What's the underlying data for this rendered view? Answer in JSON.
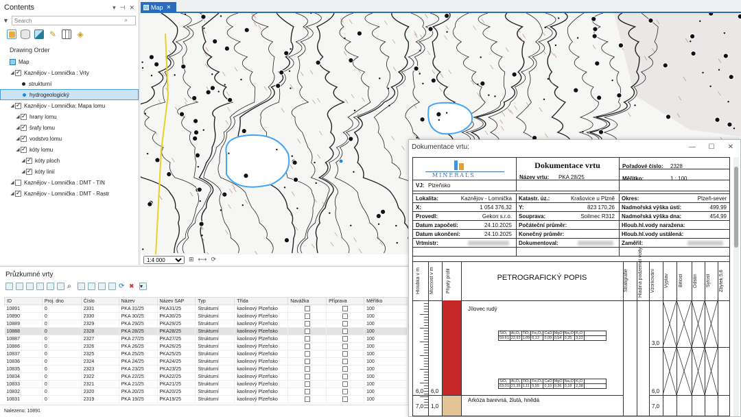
{
  "contents": {
    "title": "Contents",
    "search_placeholder": "Search",
    "section": "Drawing Order",
    "tree": [
      {
        "label": "Map",
        "level": 0,
        "checkbox": false,
        "caret": false
      },
      {
        "label": "Kaznějov - Lomnička : Vrty",
        "level": 1,
        "checkbox": true,
        "checked": true,
        "caret": true
      },
      {
        "label": "strukturní",
        "level": 2,
        "symbol": "#222222"
      },
      {
        "label": "hydrogeologický",
        "level": 2,
        "symbol": "#1e88e5",
        "selected": true
      },
      {
        "label": "Kaznějov - Lomnička: Mapa lomu",
        "level": 1,
        "checkbox": true,
        "checked": true,
        "caret": true
      },
      {
        "label": "hrany lomu",
        "level": 2,
        "checkbox": true,
        "checked": true,
        "caret": true
      },
      {
        "label": "šrafy lomu",
        "level": 2,
        "checkbox": true,
        "checked": true,
        "caret": true
      },
      {
        "label": "vodstvo lomu",
        "level": 2,
        "checkbox": true,
        "checked": true,
        "caret": true
      },
      {
        "label": "kóty lomu",
        "level": 2,
        "checkbox": true,
        "checked": true,
        "caret": true
      },
      {
        "label": "kóty ploch",
        "level": 3,
        "checkbox": true,
        "checked": true,
        "caret": true
      },
      {
        "label": "kóty linií",
        "level": 3,
        "checkbox": true,
        "checked": true,
        "caret": true
      },
      {
        "label": "Kaznějov - Lomnička : DMT - TIN",
        "level": 1,
        "checkbox": true,
        "checked": false,
        "caret": true
      },
      {
        "label": "Kaznějov - Lomnička : DMT - Rastr",
        "level": 1,
        "checkbox": true,
        "checked": true,
        "caret": true
      }
    ]
  },
  "map": {
    "tab_label": "Map",
    "scale": "1:4 000"
  },
  "table": {
    "title": "Průzkumné vrty",
    "columns": [
      "ID",
      "Proj. dno",
      "Číslo",
      "Název",
      "Název SAP",
      "Typ",
      "Třída",
      "Navážka",
      "Příprava",
      "Měřítko"
    ],
    "rows": [
      [
        "10891",
        "0",
        "2331",
        "PKA 31/25",
        "PKA31/25",
        "Strukturní",
        "kaolinový Plzeňsko",
        "",
        "",
        "100"
      ],
      [
        "10890",
        "0",
        "2330",
        "PKA 30/25",
        "PKA30/25",
        "Strukturní",
        "kaolinový Plzeňsko",
        "",
        "",
        "100"
      ],
      [
        "10889",
        "0",
        "2329",
        "PKA 29/25",
        "PKA29/25",
        "Strukturní",
        "kaolinový Plzeňsko",
        "",
        "",
        "100"
      ],
      [
        "10888",
        "0",
        "2328",
        "PKA 28/25",
        "PKA28/25",
        "Strukturní",
        "kaolinový Plzeňsko",
        "",
        "",
        "100"
      ],
      [
        "10887",
        "0",
        "2327",
        "PKA 27/25",
        "PKA27/25",
        "Strukturní",
        "kaolinový Plzeňsko",
        "",
        "",
        "100"
      ],
      [
        "10886",
        "0",
        "2326",
        "PKA 26/25",
        "PKA26/25",
        "Strukturní",
        "kaolinový Plzeňsko",
        "",
        "",
        "100"
      ],
      [
        "10837",
        "0",
        "2325",
        "PKA 25/25",
        "PKA25/25",
        "Strukturní",
        "kaolinový Plzeňsko",
        "",
        "",
        "100"
      ],
      [
        "10836",
        "0",
        "2324",
        "PKA 24/25",
        "PKA24/25",
        "Strukturní",
        "kaolinový Plzeňsko",
        "",
        "",
        "100"
      ],
      [
        "10835",
        "0",
        "2323",
        "PKA 23/25",
        "PKA23/25",
        "Strukturní",
        "kaolinový Plzeňsko",
        "",
        "",
        "100"
      ],
      [
        "10834",
        "0",
        "2322",
        "PKA 22/25",
        "PKA22/25",
        "Strukturní",
        "kaolinový Plzeňsko",
        "",
        "",
        "100"
      ],
      [
        "10833",
        "0",
        "2321",
        "PKA 21/25",
        "PKA21/25",
        "Strukturní",
        "kaolinový Plzeňsko",
        "",
        "",
        "100"
      ],
      [
        "10832",
        "0",
        "2320",
        "PKA 20/25",
        "PKA20/25",
        "Strukturní",
        "kaolinový Plzeňsko",
        "",
        "",
        "100"
      ],
      [
        "10831",
        "0",
        "2319",
        "PKA 19/25",
        "PKA19/25",
        "Strukturní",
        "kaolinový Plzeňsko",
        "",
        "",
        "100"
      ]
    ],
    "highlight_row": 3,
    "found": "Nalezeno: 10891"
  },
  "dialog": {
    "title": "Dokumentace vrtu:",
    "doc": {
      "logo_text": "MINERALS",
      "heading": "Dokumentace vrtu",
      "poradove_label": "Pořadové číslo:",
      "poradove": "2328",
      "nazev_label": "Název vrtu:",
      "nazev": "PKA 28/25",
      "meritko_label": "Měřítko:",
      "meritko": "1 : 100",
      "vj_label": "VJ:",
      "vj": "Plzeňsko",
      "lokalita_label": "Lokalita:",
      "lokalita": "Kaznějov - Lomnička",
      "katastr_label": "Katastr. úz.:",
      "katastr": "Krašovice u Plzně",
      "okres_label": "Okres:",
      "okres": "Plzeň-sever",
      "x_label": "X:",
      "x": "1 054 376,32",
      "y_label": "Y:",
      "y": "823 170,26",
      "nv_usti_label": "Nadmořská výška ústí:",
      "nv_usti": "499,99",
      "provedl_label": "Provedl:",
      "provedl": "Gekon s.r.o.",
      "souprava_label": "Souprava:",
      "souprava": "Soilmec R312",
      "nv_dna_label": "Nadmořská výška dna:",
      "nv_dna": "454,99",
      "zapoceti_label": "Datum započetí:",
      "zapoceti": "24.10.2025",
      "poc_prumer_label": "Počáteční průměr:",
      "hl_narazena_label": "Hloub.hl.vody naražena:",
      "ukonceni_label": "Datum ukončení:",
      "ukonceni": "24.10.2025",
      "kon_prumer_label": "Konečný průměr:",
      "hl_ustalena_label": "Hloub.hl.vody ustálená:",
      "vrtmistr_label": "Vrtmistr:",
      "dokumentoval_label": "Dokumentoval:",
      "zamer_label": "Zaměřil:",
      "col_hloubka": "Hloubka v m",
      "col_mocnost": "Mocnost v m",
      "col_profil": "Přijatý profil",
      "col_popis": "PETROGRAFICKÝ POPIS",
      "col_strat": "Stratigrafie",
      "col_hladina": "Hladina podzemní vody",
      "col_vzorkovani": "Vzorkování",
      "col_vyplav": "Výplav",
      "col_belost": "Bělost",
      "col_odstin": "Odstín",
      "col_sytost": "Sytost",
      "col_zbytek": "Zbytek 5,6",
      "layer1": "Jílovec rudý",
      "layer2": "Arkóza barevná, žlutá, hnědá",
      "depth1": "6,0",
      "mocnost1": "6,0",
      "depth2": "7,0",
      "mocnost2": "1,0",
      "right_30": "3,0",
      "right_60": "6,0",
      "right_70": "7,0",
      "chem_head": [
        "SiO₂",
        "Al₂O₃",
        "TiO₂",
        "Fe₂O₃",
        "CaO",
        "MgO",
        "Na₂O",
        "K₂O"
      ],
      "chem1": [
        "59,61",
        "22,93",
        "1,09",
        "6,12",
        "0,09",
        "0,54",
        "0,25",
        "3,22"
      ],
      "chem2": [
        "63,01",
        "21,35",
        "1,11",
        "5,55",
        "0,10",
        "0,36",
        "0,18",
        "2,38"
      ]
    }
  },
  "colors": {
    "accent": "#2b6bbf",
    "profile_red": "#c62828",
    "profile_tan": "#e3c497",
    "water": "#42a5f5"
  }
}
